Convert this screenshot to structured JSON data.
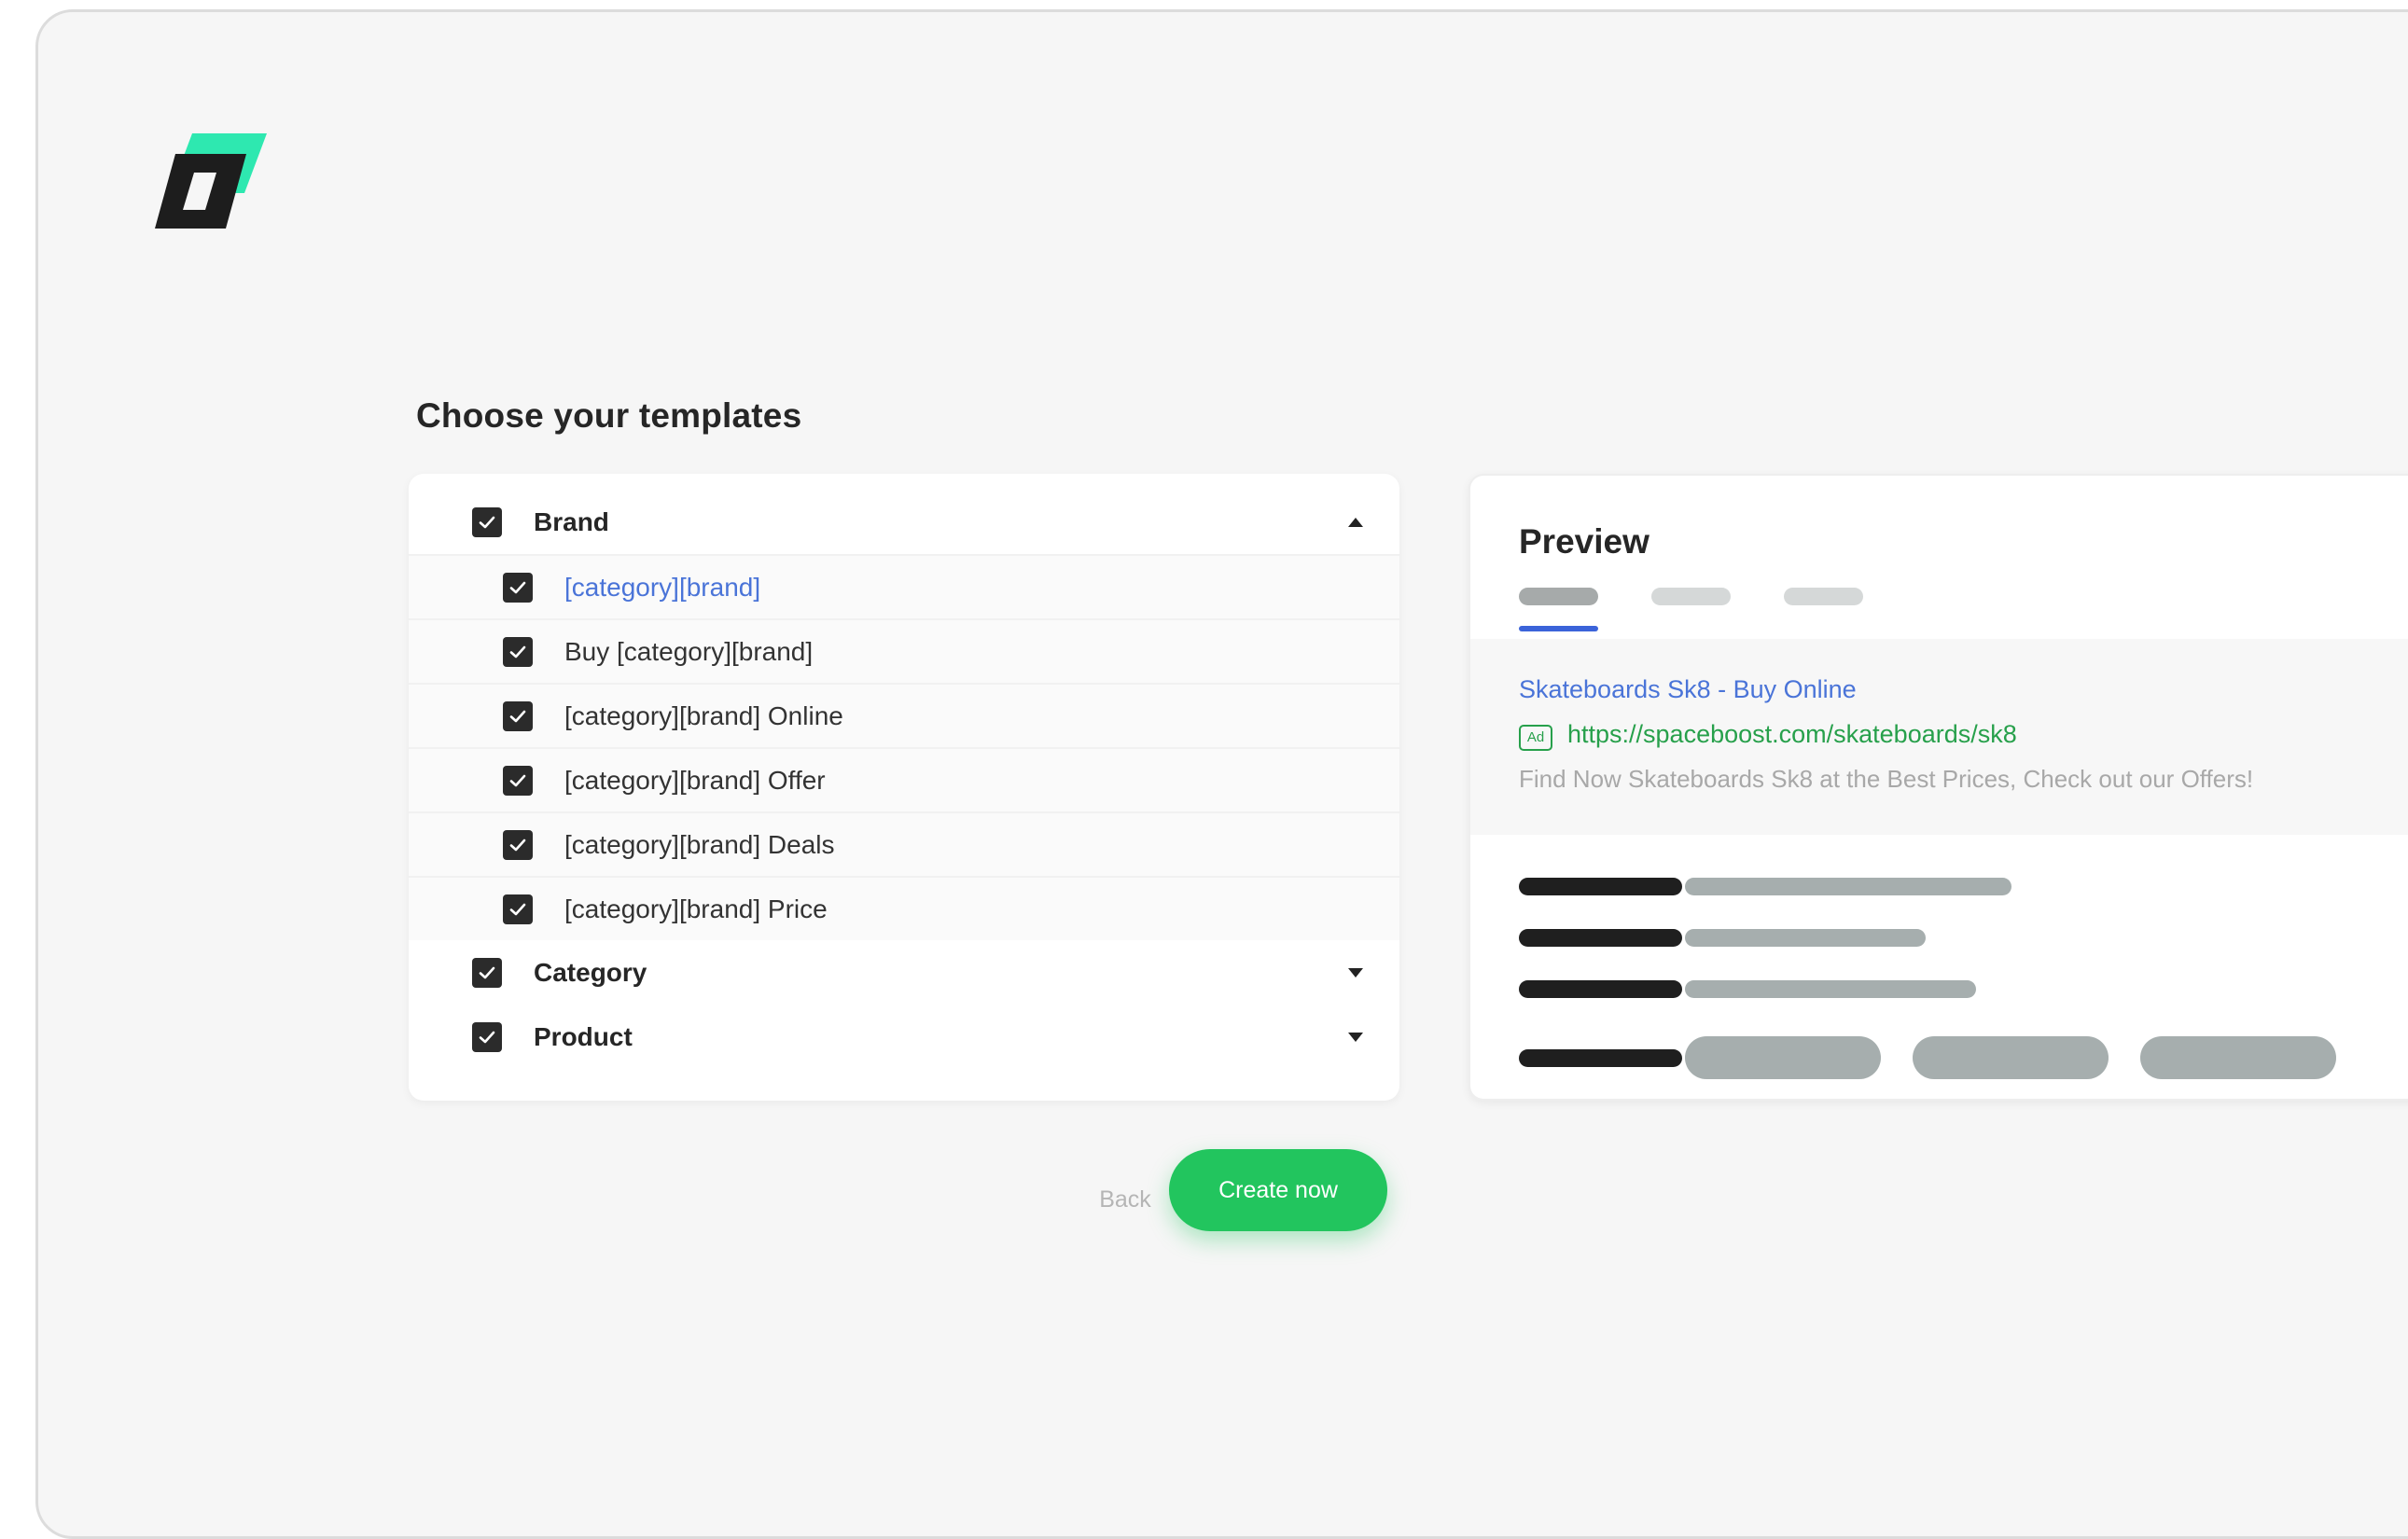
{
  "page": {
    "title": "Choose your templates",
    "logo_icon": "brand-logo-icon"
  },
  "templates": {
    "groups": [
      {
        "label": "Brand",
        "checked": true,
        "expanded": true,
        "items": [
          {
            "label": "[category][brand]",
            "checked": true,
            "active": true
          },
          {
            "label": "Buy [category][brand]",
            "checked": true
          },
          {
            "label": "[category][brand] Online",
            "checked": true
          },
          {
            "label": "[category][brand] Offer",
            "checked": true
          },
          {
            "label": "[category][brand] Deals",
            "checked": true
          },
          {
            "label": "[category][brand] Price",
            "checked": true
          }
        ]
      },
      {
        "label": "Category",
        "checked": true,
        "expanded": false
      },
      {
        "label": "Product",
        "checked": true,
        "expanded": false
      }
    ]
  },
  "actions": {
    "back_label": "Back",
    "create_label": "Create now"
  },
  "preview": {
    "title": "Preview",
    "active_tab": 0,
    "ad": {
      "title": "Skateboards Sk8 - Buy Online",
      "badge": "Ad",
      "url": "https://spaceboost.com/skateboards/sk8",
      "description": "Find Now Skateboards Sk8 at the Best Prices, Check out our Offers!"
    }
  },
  "colors": {
    "accent_green": "#22c55e",
    "link_blue": "#4a74d8",
    "url_green": "#27a04b",
    "tab_blue": "#3b63d9",
    "logo_teal": "#2ee8b0"
  }
}
